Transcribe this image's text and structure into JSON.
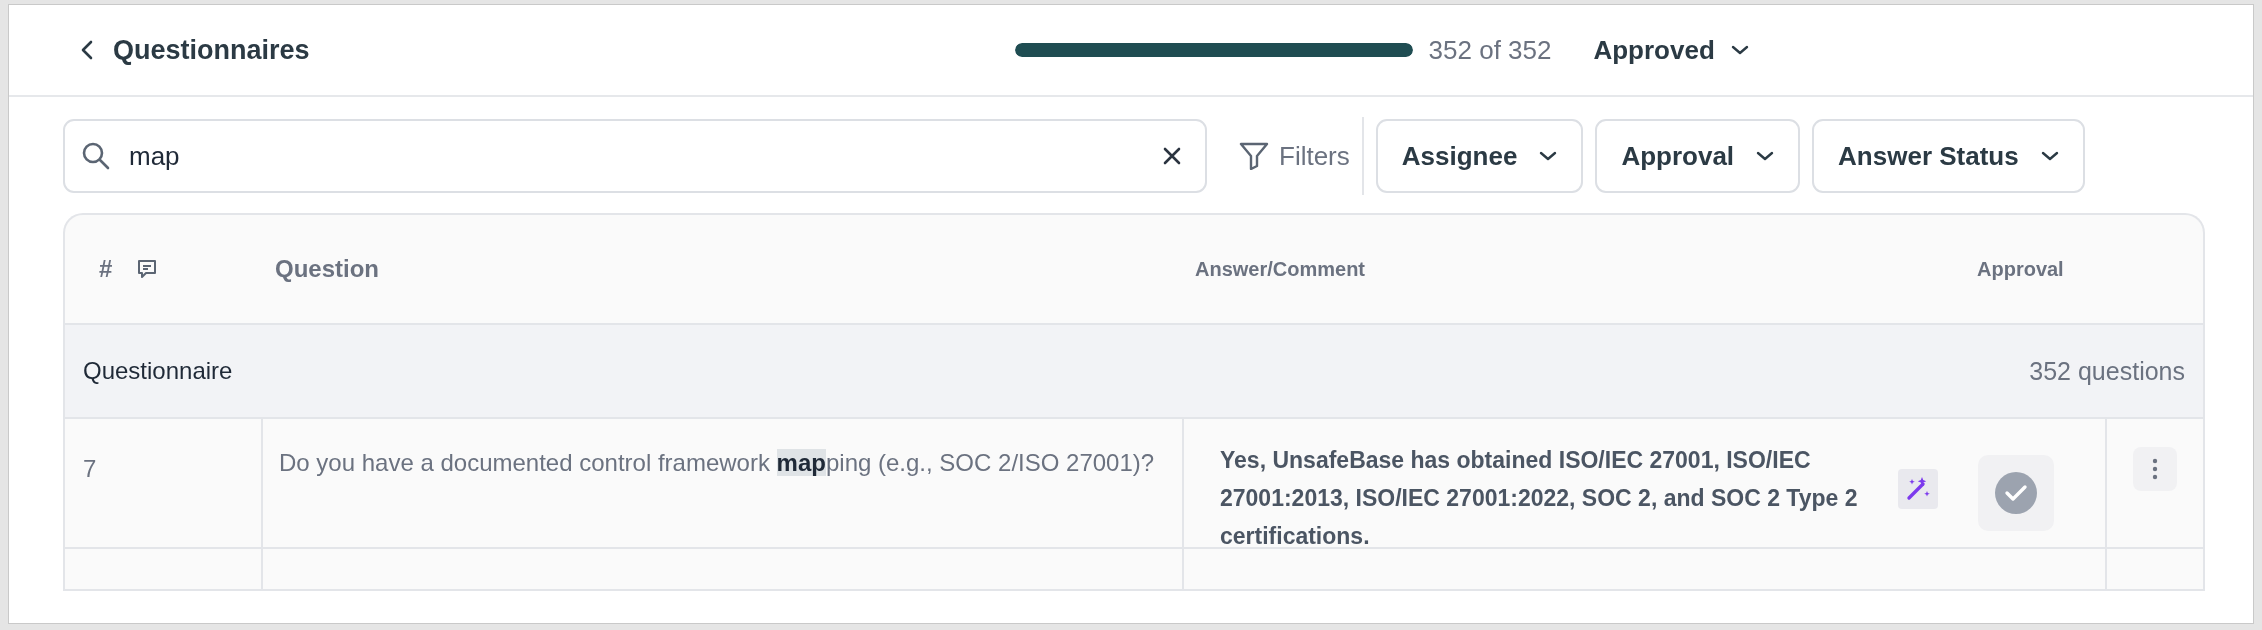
{
  "header": {
    "back_label": "Questionnaires",
    "progress": {
      "level": 1,
      "reading": "352 of 352"
    },
    "status_dropdown": "Approved"
  },
  "search": {
    "value": "map"
  },
  "filters_label": "Filters",
  "filter_dropdowns": [
    "Assignee",
    "Approval",
    "Answer Status"
  ],
  "table": {
    "columns": [
      "#",
      "Question",
      "Answer/Comment",
      "Approval"
    ],
    "group": {
      "title": "Questionnaire",
      "count": "352 questions"
    },
    "rows": [
      {
        "number": "7",
        "question": "Do you have a documented control framework **map**ping (e.g., SOC 2/ISO 27001)?",
        "answer": "Yes, UnsafeBase has obtained ISO/IEC 27001, ISO/IEC 27001:2013, ISO/IEC 27001:2022, SOC 2, and SOC 2 Type 2 certifications.",
        "ai_generated": true,
        "approved": true
      }
    ]
  }
}
